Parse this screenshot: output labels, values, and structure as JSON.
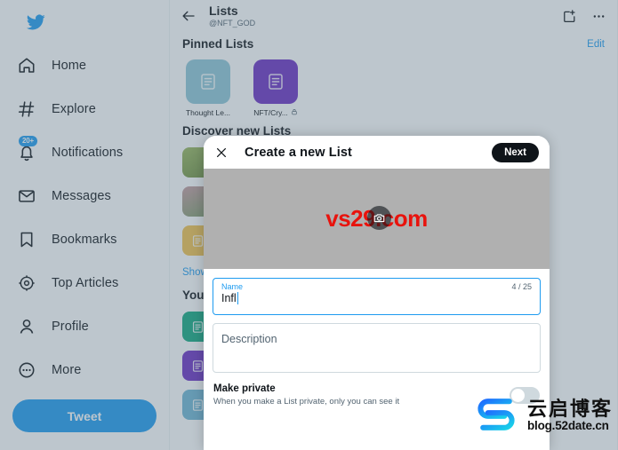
{
  "sidebar": {
    "logo_icon": "twitter-bird-icon",
    "items": [
      {
        "label": "Home",
        "icon": "home-icon",
        "badge": ""
      },
      {
        "label": "Explore",
        "icon": "hashtag-icon",
        "badge": ""
      },
      {
        "label": "Notifications",
        "icon": "bell-icon",
        "badge": "20+"
      },
      {
        "label": "Messages",
        "icon": "envelope-icon",
        "badge": ""
      },
      {
        "label": "Bookmarks",
        "icon": "bookmark-icon",
        "badge": ""
      },
      {
        "label": "Top Articles",
        "icon": "spark-icon",
        "badge": ""
      },
      {
        "label": "Profile",
        "icon": "person-icon",
        "badge": ""
      },
      {
        "label": "More",
        "icon": "more-circle-icon",
        "badge": ""
      }
    ],
    "tweet_button": "Tweet"
  },
  "header": {
    "back_icon": "back-arrow-icon",
    "title": "Lists",
    "handle": "@NFT_GOD",
    "new_list_icon": "new-list-icon",
    "more_icon": "more-horizontal-icon"
  },
  "pinned": {
    "section_title": "Pinned Lists",
    "edit_label": "Edit",
    "items": [
      {
        "name": "Thought Le...",
        "color": "#8ec6d8",
        "private": false
      },
      {
        "name": "NFT/Cry...",
        "color": "#6b2fc4",
        "private": true
      }
    ]
  },
  "discover": {
    "section_title": "Discover new Lists",
    "rows": [
      {
        "color": "#8aa05a",
        "avatar": true
      },
      {
        "color": "#b48b8f",
        "avatar": true
      },
      {
        "color": "#f2c14e",
        "avatar": false
      }
    ],
    "show_more": "Show more"
  },
  "your_lists": {
    "section_title": "Your Lists",
    "rows": [
      {
        "color": "#12a97f"
      },
      {
        "color": "#6b2fc4"
      },
      {
        "color": "#6fb6d4"
      }
    ]
  },
  "modal": {
    "close_icon": "close-x-icon",
    "title": "Create a new List",
    "next_label": "Next",
    "banner": {
      "watermark": "vs29.com",
      "watermark_color": "#e8130d",
      "camera_icon": "camera-icon",
      "bg_color": "#b0b0b0"
    },
    "name_field": {
      "label": "Name",
      "value": "Infl",
      "counter": "4 / 25"
    },
    "description_field": {
      "placeholder": "Description"
    },
    "private": {
      "title": "Make private",
      "subtitle": "When you make a List private, only you can see it",
      "enabled": false
    }
  },
  "watermark": {
    "logo_icon": "yunqi-logo-icon",
    "cn_text": "云启博客",
    "url_text": "blog.52date.cn"
  }
}
